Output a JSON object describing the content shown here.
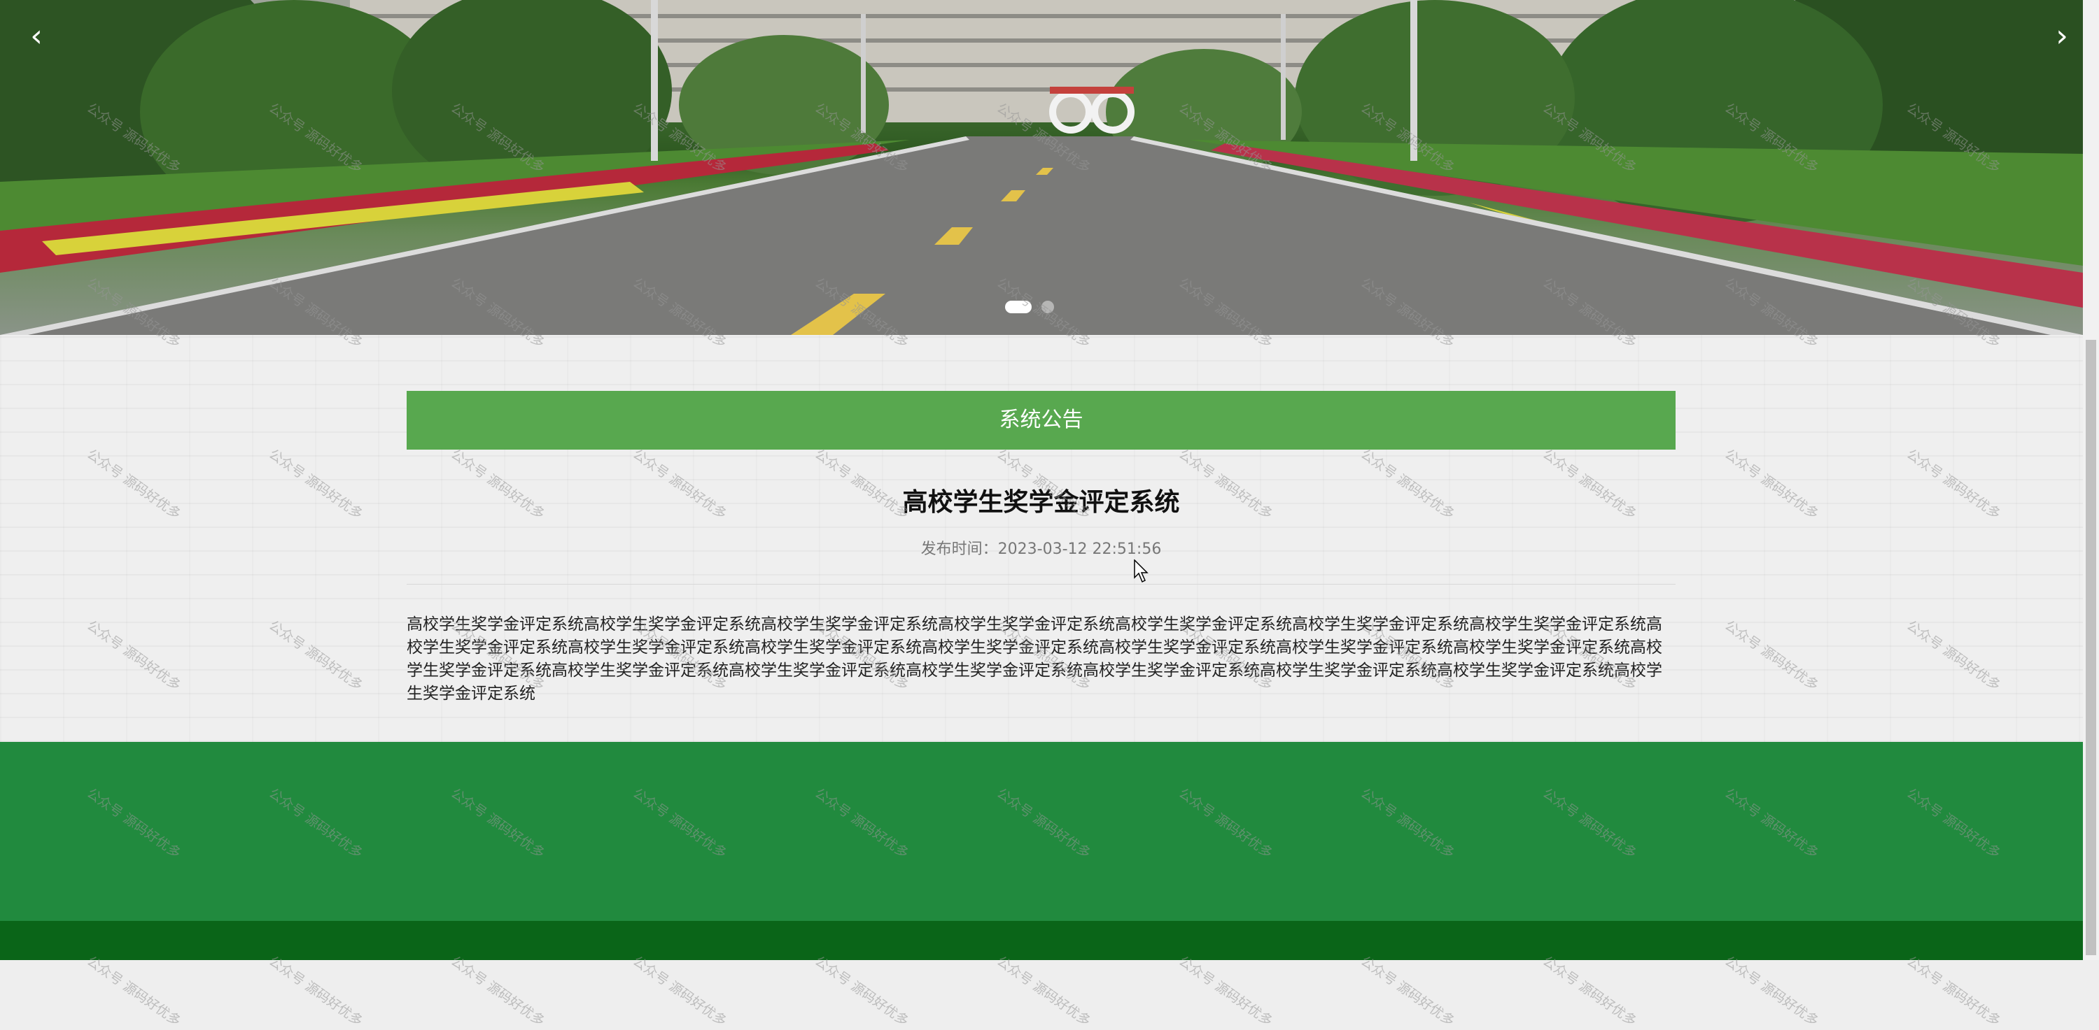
{
  "banner": {
    "prev_label": "‹",
    "next_label": "›",
    "slides_count": 2,
    "active_slide": 1
  },
  "notice": {
    "header": "系统公告",
    "title": "高校学生奖学金评定系统",
    "publish_label": "发布时间：",
    "publish_time": "2023-03-12 22:51:56",
    "body": "高校学生奖学金评定系统高校学生奖学金评定系统高校学生奖学金评定系统高校学生奖学金评定系统高校学生奖学金评定系统高校学生奖学金评定系统高校学生奖学金评定系统高校学生奖学金评定系统高校学生奖学金评定系统高校学生奖学金评定系统高校学生奖学金评定系统高校学生奖学金评定系统高校学生奖学金评定系统高校学生奖学金评定系统高校学生奖学金评定系统高校学生奖学金评定系统高校学生奖学金评定系统高校学生奖学金评定系统高校学生奖学金评定系统高校学生奖学金评定系统高校学生奖学金评定系统高校学生奖学金评定系统"
  },
  "watermark_text": "公众号 源码好优多",
  "colors": {
    "notice_header": "#58a84f",
    "footer": "#218a3e",
    "footer_bottom": "#0a6518"
  }
}
